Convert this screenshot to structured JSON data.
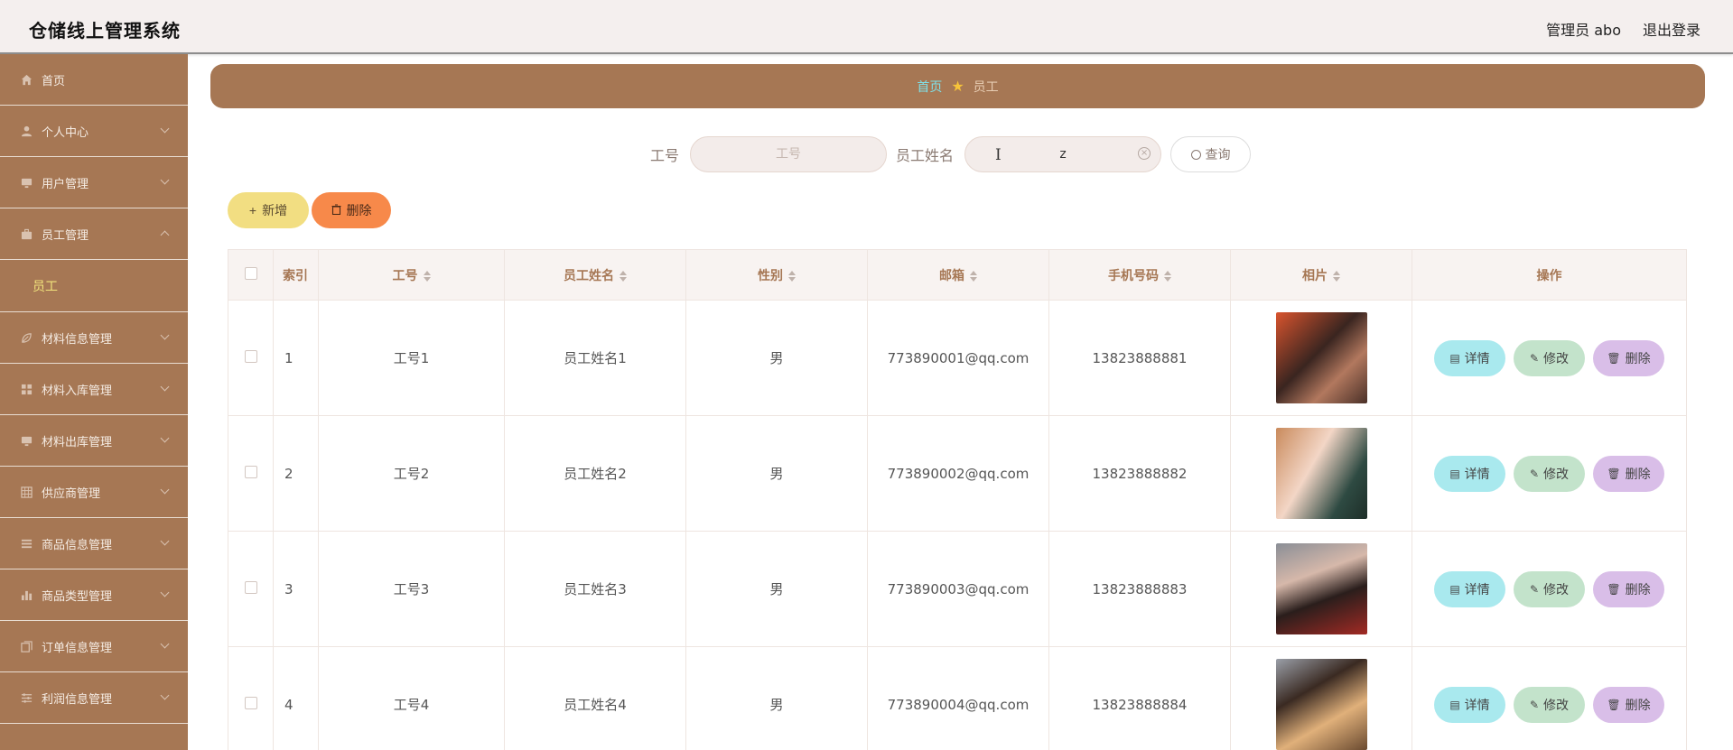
{
  "header": {
    "app_title": "仓储线上管理系统",
    "user_label": "管理员 abo",
    "logout_label": "退出登录"
  },
  "sidebar": {
    "items": [
      {
        "label": "首页",
        "icon": "home-icon",
        "expanded": null
      },
      {
        "label": "个人中心",
        "icon": "user-icon",
        "expanded": false
      },
      {
        "label": "用户管理",
        "icon": "monitor-icon",
        "expanded": false
      },
      {
        "label": "员工管理",
        "icon": "briefcase-icon",
        "expanded": true,
        "children": [
          {
            "label": "员工"
          }
        ]
      },
      {
        "label": "材料信息管理",
        "icon": "leaf-icon",
        "expanded": false
      },
      {
        "label": "材料入库管理",
        "icon": "grid-icon",
        "expanded": false
      },
      {
        "label": "材料出库管理",
        "icon": "monitor-icon",
        "expanded": false
      },
      {
        "label": "供应商管理",
        "icon": "table-icon",
        "expanded": false
      },
      {
        "label": "商品信息管理",
        "icon": "list-icon",
        "expanded": false
      },
      {
        "label": "商品类型管理",
        "icon": "bar-chart-icon",
        "expanded": false
      },
      {
        "label": "订单信息管理",
        "icon": "copy-icon",
        "expanded": false
      },
      {
        "label": "利润信息管理",
        "icon": "sliders-icon",
        "expanded": false
      }
    ]
  },
  "breadcrumb": {
    "home": "首页",
    "current": "员工"
  },
  "search": {
    "field1_label": "工号",
    "field1_placeholder": "工号",
    "field1_value": "",
    "field2_label": "员工姓名",
    "field2_value": "z",
    "query_label": "查询"
  },
  "actions": {
    "add_label": "新增",
    "delete_label": "删除"
  },
  "table": {
    "columns": [
      "索引",
      "工号",
      "员工姓名",
      "性别",
      "邮箱",
      "手机号码",
      "相片",
      "操作"
    ],
    "rows": [
      {
        "index": "1",
        "number": "工号1",
        "name": "员工姓名1",
        "gender": "男",
        "email": "773890001@qq.com",
        "phone": "13823888881"
      },
      {
        "index": "2",
        "number": "工号2",
        "name": "员工姓名2",
        "gender": "男",
        "email": "773890002@qq.com",
        "phone": "13823888882"
      },
      {
        "index": "3",
        "number": "工号3",
        "name": "员工姓名3",
        "gender": "男",
        "email": "773890003@qq.com",
        "phone": "13823888883"
      },
      {
        "index": "4",
        "number": "工号4",
        "name": "员工姓名4",
        "gender": "男",
        "email": "773890004@qq.com",
        "phone": "13823888884"
      }
    ],
    "row_actions": {
      "detail": "详情",
      "edit": "修改",
      "delete": "删除"
    }
  },
  "colors": {
    "accent_brown": "#a67754",
    "sidebar_active": "#f2e47c",
    "add_button": "#f2de82",
    "delete_button": "#f7894a",
    "detail_button": "#a9e9ee",
    "edit_button": "#c3e3cb",
    "row_delete_button": "#d9bee8"
  }
}
